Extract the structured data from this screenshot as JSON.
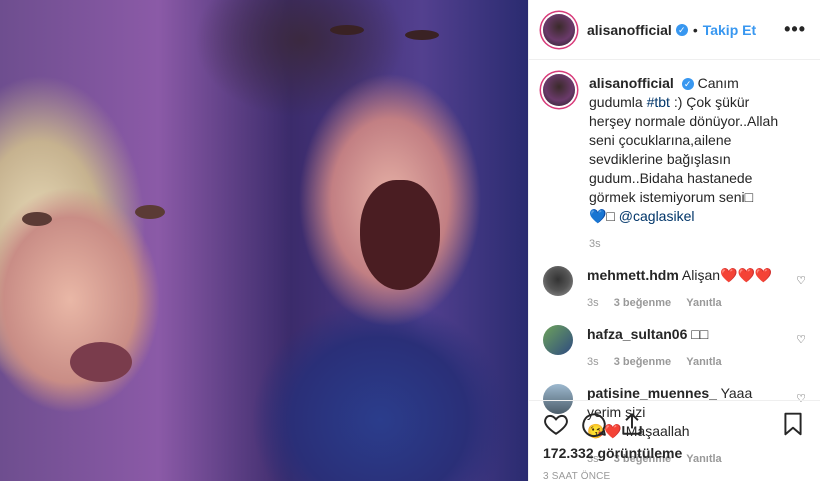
{
  "post": {
    "username": "alisanofficial",
    "follow_label": "Takip Et",
    "more_label": "•••"
  },
  "caption": {
    "username": "alisanofficial",
    "text_before": "Canım gudumla ",
    "hashtag": "#tbt",
    "text_after": " :) Çok şükür herşey normale dönüyor..Allah seni çocuklarına,ailene sevdiklerine bağışlasın gudum..Bidaha hastanede görmek istemiyorum seni□",
    "line2_prefix": "💙□ ",
    "mention": "@caglasikel",
    "time": "3s"
  },
  "comments": [
    {
      "username": "mehmett.hdm",
      "text": "Alişan",
      "emoji": "❤️❤️❤️",
      "time": "3s",
      "likes": "3 beğenme",
      "reply": "Yanıtla"
    },
    {
      "username": "hafza_sultan06",
      "text": "□□",
      "emoji": "",
      "time": "3s",
      "likes": "3 beğenme",
      "reply": "Yanıtla"
    },
    {
      "username": "patisine_muennes_",
      "text": "Yaaa yerim sizi",
      "emoji": "😘❤️",
      "text2": "Maşaallah",
      "time": "3s",
      "likes": "3 beğenme",
      "reply": "Yanıtla"
    }
  ],
  "stats": {
    "views": "172.332 görüntüleme",
    "posted": "3 SAAT ÖNCE"
  },
  "icons": [
    "heart-icon",
    "comment-icon",
    "share-icon",
    "bookmark-icon",
    "verified-icon"
  ],
  "colors": {
    "link": "#3897f0",
    "verified": "#3897f0",
    "like": "#ed4956"
  }
}
